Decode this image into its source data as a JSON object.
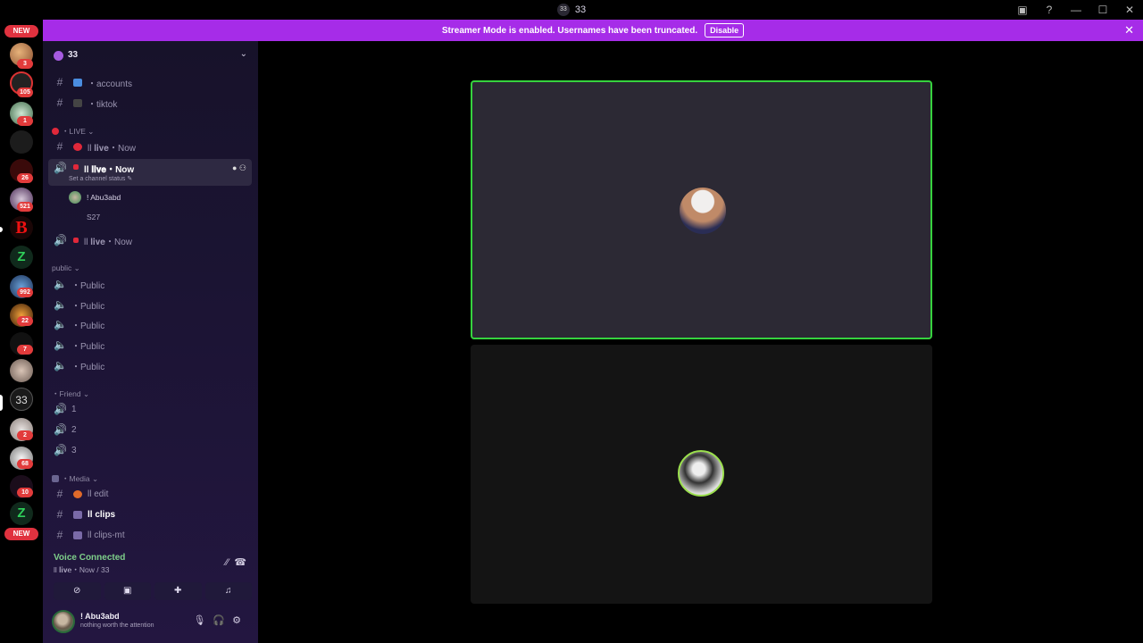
{
  "titlebar": {
    "server_icon_text": "33",
    "title": "33"
  },
  "banner": {
    "message": "Streamer Mode is enabled. Usernames have been truncated.",
    "disable_label": "Disable"
  },
  "rail": {
    "new_top": "NEW",
    "new_bottom": "NEW",
    "badges": [
      "3",
      "105",
      "1",
      "26",
      "521",
      "992",
      "22",
      "7",
      "2",
      "68",
      "10"
    ]
  },
  "guild": {
    "name": "33"
  },
  "channels": {
    "accounts": "・accounts",
    "tiktok": "・tiktok",
    "cat_live": "・LIVE ⌄",
    "live_text": "ll 𝐥𝐢𝐯𝐞・Now",
    "live_voice_active": "ll 𝐥𝐢𝐯𝐞・Now",
    "set_status": "Set a channel status ✎",
    "user1": "! Abu3abd",
    "user2": "S27",
    "live_voice2": "ll 𝐥𝐢𝐯𝐞・Now",
    "cat_public": "public ⌄",
    "public": [
      "・Public",
      "・Public",
      "・Public",
      "・Public",
      "・Public"
    ],
    "cat_friend": "・Friend ⌄",
    "friend": [
      "1",
      "2",
      "3"
    ],
    "cat_media": "・Media ⌄",
    "edit": "ll edit",
    "clips": "ll clips",
    "clips_mt": "ll clips-mt"
  },
  "voice": {
    "connected": "Voice Connected",
    "channel": "ll 𝐥𝐢𝐯𝐞・Now / 33"
  },
  "user": {
    "name": "! Abu3abd",
    "status": "nothing worth the attention"
  },
  "colors": {
    "banner": "#a62ce8",
    "sidebar": "#1b1433",
    "speaking_border": "#36d23e",
    "live_red": "#e0283a"
  }
}
